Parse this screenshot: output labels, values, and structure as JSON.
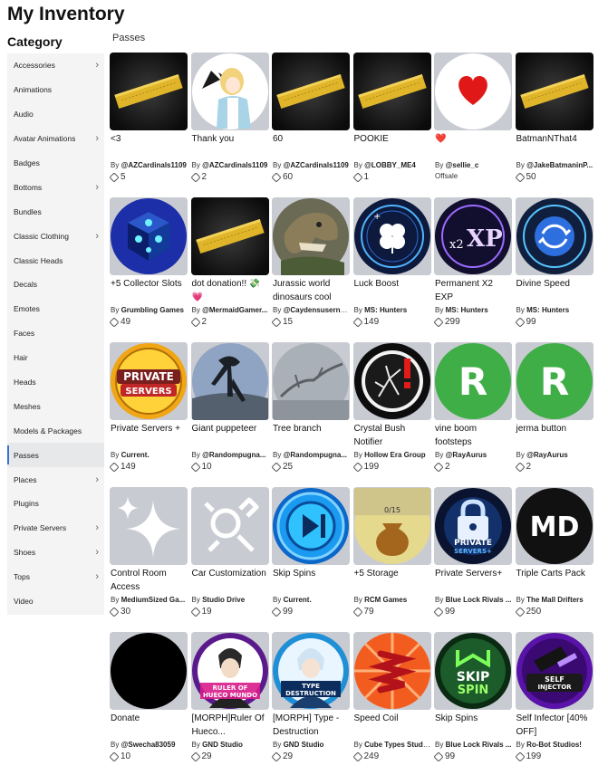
{
  "page": {
    "title": "My Inventory",
    "category_heading": "Category",
    "section": "Passes",
    "by_prefix": "By "
  },
  "sidebar": {
    "items": [
      {
        "label": "Accessories",
        "chevron": true
      },
      {
        "label": "Animations",
        "chevron": false
      },
      {
        "label": "Audio",
        "chevron": false
      },
      {
        "label": "Avatar Animations",
        "chevron": true
      },
      {
        "label": "Badges",
        "chevron": false
      },
      {
        "label": "Bottoms",
        "chevron": true
      },
      {
        "label": "Bundles",
        "chevron": false
      },
      {
        "label": "Classic Clothing",
        "chevron": true
      },
      {
        "label": "Classic Heads",
        "chevron": false
      },
      {
        "label": "Decals",
        "chevron": false
      },
      {
        "label": "Emotes",
        "chevron": false
      },
      {
        "label": "Faces",
        "chevron": false
      },
      {
        "label": "Hair",
        "chevron": false
      },
      {
        "label": "Heads",
        "chevron": false
      },
      {
        "label": "Meshes",
        "chevron": false
      },
      {
        "label": "Models & Packages",
        "chevron": false
      },
      {
        "label": "Passes",
        "chevron": false,
        "active": true
      },
      {
        "label": "Places",
        "chevron": true
      },
      {
        "label": "Plugins",
        "chevron": false
      },
      {
        "label": "Private Servers",
        "chevron": true
      },
      {
        "label": "Shoes",
        "chevron": true
      },
      {
        "label": "Tops",
        "chevron": true
      },
      {
        "label": "Video",
        "chevron": false
      }
    ],
    "chevron_glyph": "›"
  },
  "items": [
    {
      "name": "<3",
      "creator": "@AZCardinals1109",
      "price": "5",
      "icon": "gold-ticket-icon"
    },
    {
      "name": "Thank you",
      "creator": "@AZCardinals1109",
      "price": "2",
      "icon": "anime-girl-icon"
    },
    {
      "name": "60",
      "creator": "@AZCardinals1109",
      "price": "60",
      "icon": "gold-ticket-icon"
    },
    {
      "name": "POOKIE",
      "creator": "@LOBBY_ME4",
      "price": "1",
      "icon": "gold-ticket-icon"
    },
    {
      "name": "❤️",
      "creator": "@sellie_c",
      "offsale": "Offsale",
      "icon": "heart-icon"
    },
    {
      "name": "BatmanNThat4",
      "creator": "@JakeBatmaninP...",
      "price": "50",
      "icon": "gold-ticket-icon"
    },
    {
      "name": "+5 Collector Slots",
      "creator": "Grumbling Games",
      "price": "49",
      "icon": "blue-cube-icon"
    },
    {
      "name": "dot donation!! 💸💗",
      "creator": "@MermaidGamer...",
      "price": "2",
      "icon": "gold-ticket-icon"
    },
    {
      "name": "Jurassic world dinosaurs cool",
      "creator": "@Caydensuserna...",
      "price": "15",
      "icon": "dinosaur-icon"
    },
    {
      "name": "Luck Boost",
      "creator": "MS: Hunters",
      "price": "149",
      "icon": "clover-icon"
    },
    {
      "name": "Permanent X2 EXP",
      "creator": "MS: Hunters",
      "price": "299",
      "icon": "x2-xp-icon"
    },
    {
      "name": "Divine Speed",
      "creator": "MS: Hunters",
      "price": "99",
      "icon": "divine-speed-icon"
    },
    {
      "name": "Private Servers +",
      "creator": "Current.",
      "price": "149",
      "icon": "private-servers-icon"
    },
    {
      "name": "Giant puppeteer",
      "creator": "@Randompugna...",
      "price": "10",
      "icon": "puppeteer-icon"
    },
    {
      "name": "Tree branch",
      "creator": "@Randompugna...",
      "price": "25",
      "icon": "tree-branch-icon"
    },
    {
      "name": "Crystal Bush Notifier",
      "creator": "Hollow Era Group",
      "price": "199",
      "icon": "crystal-bush-icon"
    },
    {
      "name": "vine boom footsteps",
      "creator": "@RayAurus",
      "price": "2",
      "icon": "green-r-icon"
    },
    {
      "name": "jerma button",
      "creator": "@RayAurus",
      "price": "2",
      "icon": "green-r-icon"
    },
    {
      "name": "Control Room Access",
      "creator": "MediumSized Ga...",
      "price": "30",
      "icon": "sparkle-icon"
    },
    {
      "name": "Car Customization",
      "creator": "Studio Drive",
      "price": "19",
      "icon": "wrench-icon"
    },
    {
      "name": "Skip Spins",
      "creator": "Current.",
      "price": "99",
      "icon": "skip-icon"
    },
    {
      "name": "+5 Storage",
      "creator": "RCM Games",
      "price": "79",
      "icon": "storage-bag-icon"
    },
    {
      "name": "Private Servers+",
      "creator": "Blue Lock Rivals ...",
      "price": "99",
      "icon": "lock-servers-icon"
    },
    {
      "name": "Triple Carts Pack",
      "creator": "The Mall Drifters",
      "price": "250",
      "icon": "md-logo-icon"
    },
    {
      "name": "Donate",
      "creator": "@Swecha83059",
      "price": "10",
      "icon": "black-circle-icon"
    },
    {
      "name": "[MORPH]Ruler Of Hueco...",
      "creator": "GND Studio",
      "price": "29",
      "icon": "ruler-hueco-icon"
    },
    {
      "name": "[MORPH] Type - Destruction",
      "creator": "GND Studio",
      "price": "29",
      "icon": "type-destruction-icon"
    },
    {
      "name": "Speed Coil",
      "creator": "Cube Types Studi...",
      "price": "249",
      "icon": "speed-coil-icon"
    },
    {
      "name": "Skip Spins",
      "creator": "Blue Lock Rivals ...",
      "price": "99",
      "icon": "skip-spin-icon"
    },
    {
      "name": "Self Infector [40% OFF]",
      "creator": "Ro-Bot Studios!",
      "price": "199",
      "icon": "self-injector-icon"
    }
  ],
  "thumb_texts": {
    "x2": "x2",
    "xp": "XP",
    "private": "PRIVATE",
    "servers": "SERVERS",
    "r": "R",
    "storage": "0/15",
    "private_plus": "PRIVATE",
    "servers_plus": "SERVERS+",
    "md": "MD",
    "ruler1": "RULER OF",
    "ruler2": "HUECO MUNDO",
    "type1": "TYPE",
    "type2": "DESTRUCTION",
    "skip1": "SKIP",
    "skip2": "SPIN",
    "self1": "SELF",
    "self2": "INJECTOR"
  }
}
